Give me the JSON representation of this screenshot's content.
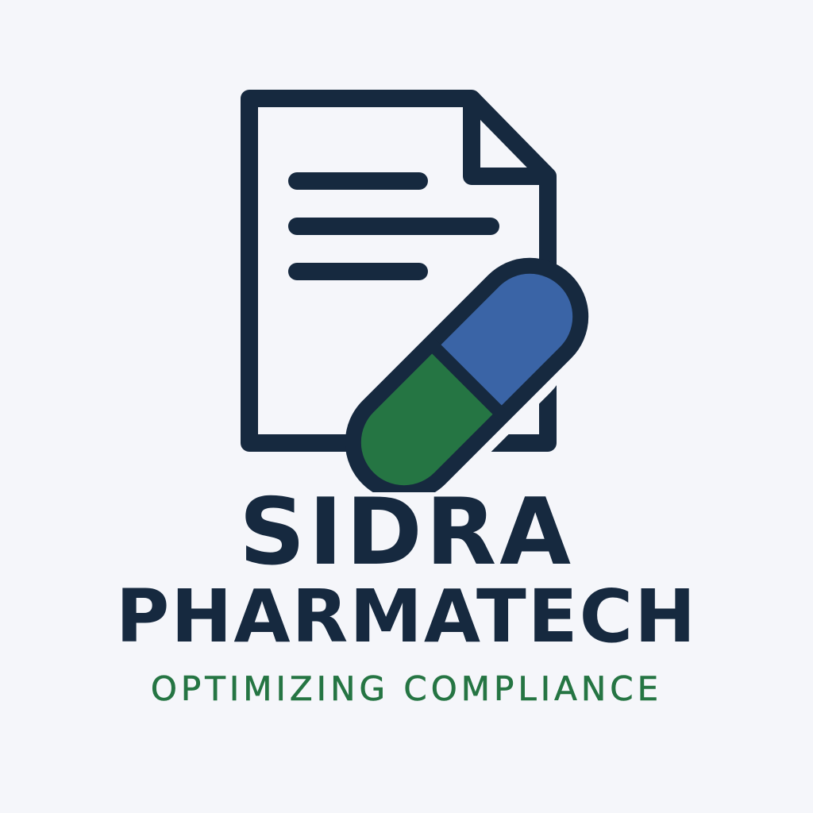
{
  "brand": {
    "name_line_1": "SIDRA",
    "name_line_2": "PHARMATECH",
    "tagline": "OPTIMIZING COMPLIANCE"
  },
  "icons": {
    "document": "document-icon",
    "capsule": "capsule-icon"
  },
  "colors": {
    "background": "#f5f6fa",
    "navy": "#16293f",
    "blue": "#3a64a6",
    "green": "#257543"
  }
}
